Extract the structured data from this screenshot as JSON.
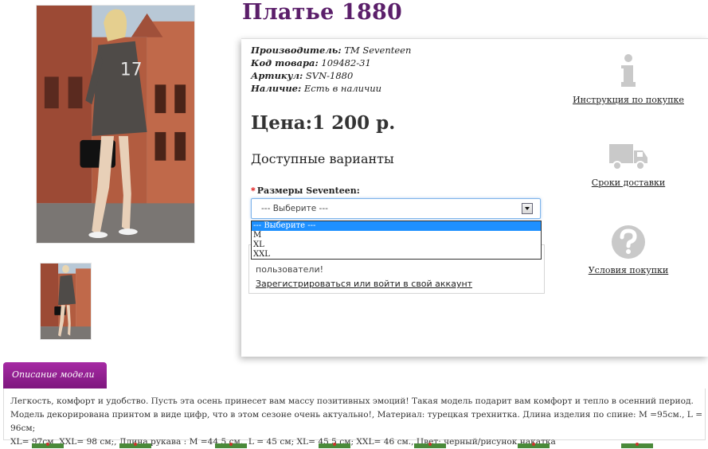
{
  "product": {
    "title": "Платье 1880",
    "manufacturer_label": "Производитель:",
    "manufacturer_value": "TM Seventeen",
    "code_label": "Код товара:",
    "code_value": "109482-31",
    "article_label": "Артикул:",
    "article_value": "SVN-1880",
    "stock_label": "Наличие:",
    "stock_value": "Есть в наличии",
    "price": "Цена:1 200 р."
  },
  "options": {
    "heading": "Доступные варианты",
    "required_mark": "*",
    "size_label": "Размеры Seventeen:",
    "select_value": "--- Выберите ---",
    "dropdown_items": [
      "--- Выберите ---",
      "M",
      "XL",
      "XXL"
    ]
  },
  "login": {
    "text": "пользователи!",
    "link": "Зарегистрироваться или войти в свой аккаунт"
  },
  "sidebar": {
    "instruction": "Инструкция по покупке",
    "delivery": "Сроки доставки",
    "conditions": "Условия покупки"
  },
  "description": {
    "tab": "Описание модели",
    "line1": "Легкость, комфорт и удобство. Пусть эта осень принесет вам массу позитивных эмоций! Такая модель подарит вам комфорт и тепло в осенний период.",
    "line2": "Модель декорирована принтом в виде цифр, что в этом сезоне очень актуально!, Материал: турецкая трехнитка. Длина изделия по спине: М =95см., L = 96см;",
    "line3": "XL= 97см, XXL= 98 см;, Длина рукава : М =44,5 см., L = 45 см; XL= 45,5 см; XXL= 46 см., Цвет: черный/рисунок накатка"
  },
  "colors": {
    "title": "#5b1f6a",
    "tab": "#8e1f8e",
    "select_highlight": "#1e90ff"
  },
  "icons": [
    "info-icon",
    "truck-icon",
    "question-icon"
  ]
}
